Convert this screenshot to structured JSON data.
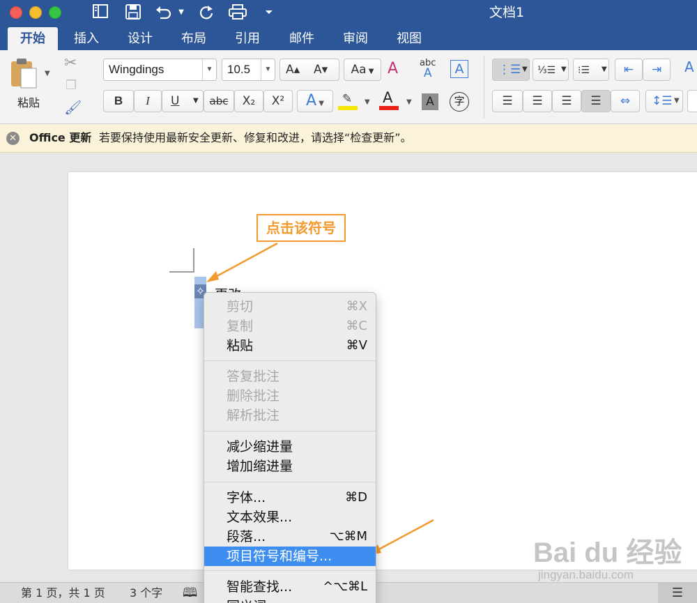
{
  "window": {
    "title": "文档1"
  },
  "quick_access": [
    {
      "name": "sidebar-icon",
      "glyph": "◧"
    },
    {
      "name": "save-icon",
      "glyph": "💾"
    },
    {
      "name": "undo-icon",
      "glyph": "↶"
    },
    {
      "name": "redo-icon",
      "glyph": "↻"
    },
    {
      "name": "print-icon",
      "glyph": "⎙"
    },
    {
      "name": "customize-icon",
      "glyph": "⏷"
    }
  ],
  "tabs": [
    "开始",
    "插入",
    "设计",
    "布局",
    "引用",
    "邮件",
    "审阅",
    "视图"
  ],
  "ribbon": {
    "paste_label": "粘贴",
    "font_name": "Wingdings",
    "font_size": "10.5",
    "bold": "B",
    "italic": "I",
    "underline": "U",
    "strikethrough": "abc",
    "subscript": "X₂",
    "superscript": "X²",
    "grow_font": "A▴",
    "shrink_font": "A▾",
    "change_case": "Aa",
    "phonetic": "abc",
    "char_border": "A",
    "text_effect": "A",
    "font_color": "A",
    "char_shading": "A",
    "enclose_char": "字",
    "highlight_color": "#f5e600",
    "font_color_bar": "#e8221b"
  },
  "notification": {
    "title": "Office 更新",
    "message": "若要保持使用最新安全更新、修复和改进，请选择“检查更新”。"
  },
  "document": {
    "text": "更改",
    "bullet_char": "✧"
  },
  "annotation": {
    "label": "点击该符号"
  },
  "context_menu": {
    "items": [
      {
        "label": "剪切",
        "shortcut": "⌘X",
        "disabled": true
      },
      {
        "label": "复制",
        "shortcut": "⌘C",
        "disabled": true
      },
      {
        "label": "粘贴",
        "shortcut": "⌘V",
        "disabled": false
      },
      {
        "label": "答复批注",
        "shortcut": "",
        "disabled": true
      },
      {
        "label": "删除批注",
        "shortcut": "",
        "disabled": true
      },
      {
        "label": "解析批注",
        "shortcut": "",
        "disabled": true
      },
      {
        "label": "减少缩进量",
        "shortcut": "",
        "disabled": false
      },
      {
        "label": "增加缩进量",
        "shortcut": "",
        "disabled": false
      },
      {
        "label": "字体...",
        "shortcut": "⌘D",
        "disabled": false
      },
      {
        "label": "文本效果...",
        "shortcut": "",
        "disabled": false
      },
      {
        "label": "段落...",
        "shortcut": "⌥⌘M",
        "disabled": false
      },
      {
        "label": "项目符号和编号...",
        "shortcut": "",
        "disabled": false,
        "highlighted": true
      },
      {
        "label": "智能查找...",
        "shortcut": "^⌥⌘L",
        "disabled": false
      },
      {
        "label": "同义词",
        "shortcut": "▸",
        "disabled": false
      }
    ]
  },
  "status": {
    "page": "第 1 页，共 1 页",
    "words": "3 个字"
  },
  "watermark": {
    "main": "Bai du 经验",
    "sub": "jingyan.baidu.com"
  },
  "colors": {
    "title_bar": "#2d5699",
    "highlight": "#3d8ef0",
    "annotation": "#f29a2e"
  }
}
